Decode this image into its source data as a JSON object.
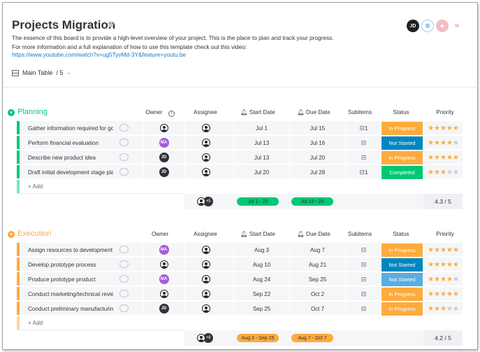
{
  "board": {
    "title": "Projects Migration",
    "desc_line1": "The essence of this board is to provide a high-level overview of your project. This is the place to plan and track your progress.",
    "desc_line2": "For more information and a full explanation of how to use this template check out this video:",
    "desc_link": "https://www.youtube.com/watch?v=ug5TyvMd-3Y&feature=youtu.be",
    "view_label": "Main Table",
    "view_count": "/ 5",
    "header_avatar": "JD"
  },
  "columns": {
    "owner": "Owner",
    "assignee": "Assignee",
    "start": "Start Date",
    "due": "Due Date",
    "subitems": "Subitems",
    "status": "Status",
    "priority": "Priority"
  },
  "colors": {
    "planning": "#00c875",
    "execution": "#fdab3d",
    "in_progress": "#fdab3d",
    "not_started": "#0086c0",
    "completed": "#00c875",
    "star": "#fdab3d"
  },
  "planning": {
    "title": "Planning",
    "add_label": "+ Add",
    "start_range": "Jul 1 - 20",
    "due_range": "Jul 15 - 28",
    "assignee_more": "+5",
    "priority_avg": "4.3 / 5",
    "rows": [
      {
        "name": "Gather information required for go/n...",
        "owner": "ghost",
        "owner_text": "",
        "start": "Jul 1",
        "due": "Jul 15",
        "subitems": "1",
        "status": "In Progress",
        "status_color": "#fdab3d",
        "stars": 5
      },
      {
        "name": "Perform financial evaluation",
        "owner": "MA",
        "owner_text": "MA",
        "start": "Jul 13",
        "due": "Jul 16",
        "subitems": "",
        "status": "Not Started",
        "status_color": "#0086c0",
        "stars": 4
      },
      {
        "name": "Describe new product idea",
        "owner": "JD",
        "owner_text": "JD",
        "start": "Jul 13",
        "due": "Jul 20",
        "subitems": "",
        "status": "In Progress",
        "status_color": "#fdab3d",
        "stars": 5
      },
      {
        "name": "Draft initial development stage plan",
        "owner": "JD",
        "owner_text": "JD",
        "start": "Jul 20",
        "due": "Jul 28",
        "subitems": "1",
        "status": "Completed",
        "status_color": "#00c875",
        "stars": 3
      }
    ]
  },
  "execution": {
    "title": "Execution",
    "add_label": "+ Add",
    "start_range": "Aug 3 - Sep 25",
    "due_range": "Aug 7 - Oct 7",
    "assignee_more": "+8",
    "priority_avg": "4.2 / 5",
    "rows": [
      {
        "name": "Assign resources to development sta...",
        "owner": "MA",
        "owner_text": "MA",
        "start": "Aug 3",
        "due": "Aug 7",
        "subitems": "",
        "status": "In Progress",
        "status_color": "#fdab3d",
        "stars": 5
      },
      {
        "name": "Develop prototype process",
        "owner": "ghost",
        "owner_text": "",
        "start": "Aug 10",
        "due": "Aug 21",
        "subitems": "",
        "status": "Not Started",
        "status_color": "#0086c0",
        "stars": 5
      },
      {
        "name": "Produce prototype product",
        "owner": "MA",
        "owner_text": "MA",
        "start": "Aug 24",
        "due": "Sep 25",
        "subitems": "",
        "status": "Not Started",
        "status_color": "#58aee0",
        "stars": 4
      },
      {
        "name": "Conduct marketing/technical review",
        "owner": "ghost",
        "owner_text": "",
        "start": "Sep 22",
        "due": "Oct 2",
        "subitems": "",
        "status": "In Progress",
        "status_color": "#fdab3d",
        "stars": 5
      },
      {
        "name": "Conduct preliminary manufacturing p...",
        "owner": "JD",
        "owner_text": "JD",
        "start": "Sep 25",
        "due": "Oct 7",
        "subitems": "",
        "status": "In Progress",
        "status_color": "#fdab3d",
        "stars": 3
      }
    ]
  }
}
